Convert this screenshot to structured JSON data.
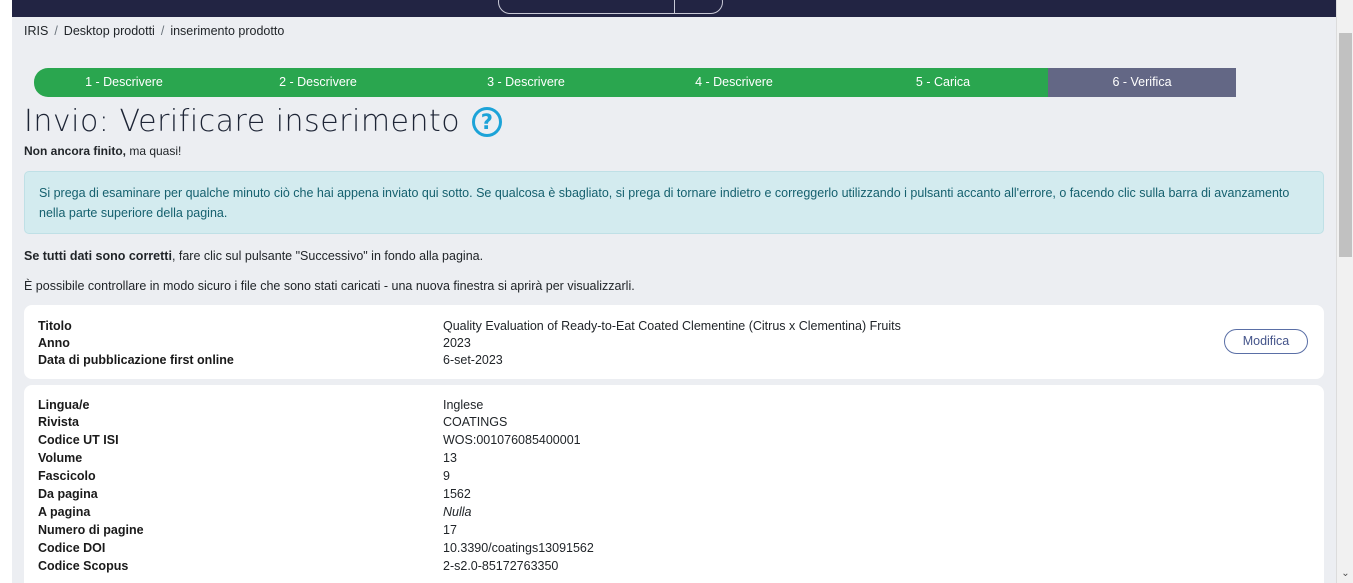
{
  "breadcrumb": {
    "root": "IRIS",
    "section": "Desktop prodotti",
    "current": "inserimento prodotto",
    "separator": "/"
  },
  "progress": {
    "steps": [
      {
        "label": "1 - Descrivere"
      },
      {
        "label": "2 - Descrivere"
      },
      {
        "label": "3 - Descrivere"
      },
      {
        "label": "4 - Descrivere"
      },
      {
        "label": "5 - Carica"
      },
      {
        "label": "6 - Verifica"
      }
    ]
  },
  "page": {
    "title": "Invio: Verificare inserimento",
    "help_icon": "?",
    "subtitle_bold": "Non ancora finito,",
    "subtitle_rest": " ma quasi!",
    "alert": "Si prega di esaminare per qualche minuto ciò che hai appena inviato qui sotto. Se qualcosa è sbagliato, si prega di tornare indietro e correggerlo utilizzando i pulsanti accanto all'errore, o facendo clic sulla barra di avanzamento nella parte superiore della pagina.",
    "line1_bold": "Se tutti dati sono corretti",
    "line1_rest": ", fare clic sul pulsante \"Successivo\" in fondo alla pagina.",
    "line2": "È possibile controllare in modo sicuro i file che sono stati caricati - una nuova finestra si aprirà per visualizzarli."
  },
  "card1": {
    "modify_label": "Modifica",
    "rows": [
      {
        "label": "Titolo",
        "value": "Quality Evaluation of Ready-to-Eat Coated Clementine (Citrus x Clementina) Fruits"
      },
      {
        "label": "Anno",
        "value": "2023"
      },
      {
        "label": "Data di pubblicazione first online",
        "value": "6-set-2023"
      }
    ]
  },
  "card2": {
    "rows": [
      {
        "label": "Lingua/e",
        "value": "Inglese"
      },
      {
        "label": "Rivista",
        "value": "COATINGS"
      },
      {
        "label": "Codice UT ISI",
        "value": "WOS:001076085400001"
      },
      {
        "label": "Volume",
        "value": "13"
      },
      {
        "label": "Fascicolo",
        "value": "9"
      },
      {
        "label": "Da pagina",
        "value": "1562"
      },
      {
        "label": "A pagina",
        "value": "Nulla"
      },
      {
        "label": "Numero di pagine",
        "value": "17"
      },
      {
        "label": "Codice DOI",
        "value": "10.3390/coatings13091562"
      },
      {
        "label": "Codice Scopus",
        "value": "2-s2.0-85172763350"
      }
    ]
  },
  "colors": {
    "step_done": "#2aa64f",
    "step_current": "#636785",
    "topbar": "#222443",
    "help": "#1ca3d8"
  }
}
